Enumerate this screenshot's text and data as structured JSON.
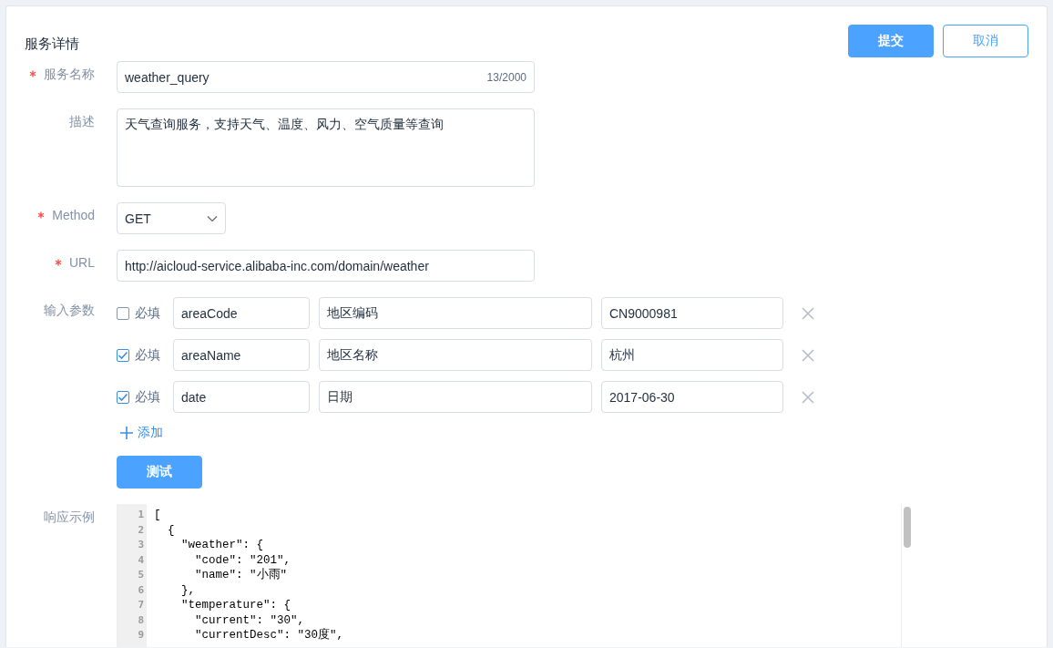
{
  "title": "服务详情",
  "actions": [
    {
      "label": "提交",
      "kind": "primary"
    },
    {
      "label": "取消",
      "kind": "secondary"
    }
  ],
  "fields": [
    {
      "label": "服务名称",
      "required": true,
      "kind": "text",
      "value": "weather_query",
      "counter": "13/2000"
    },
    {
      "label": "描述",
      "required": false,
      "kind": "textarea",
      "value": "天气查询服务，支持天气、温度、风力、空气质量等查询"
    },
    {
      "label": "Method",
      "required": true,
      "kind": "select",
      "value": "GET"
    },
    {
      "label": "URL",
      "required": true,
      "kind": "text",
      "value": "http://aicloud-service.alibaba-inc.com/domain/weather"
    }
  ],
  "params": {
    "label": "输入参数",
    "add_label": "添加",
    "test_label": "测试",
    "rows": [
      {
        "checked": false,
        "required_label": "必填",
        "name": "areaCode",
        "desc": "地区编码",
        "example": "CN9000981"
      },
      {
        "checked": true,
        "required_label": "必填",
        "name": "areaName",
        "desc": "地区名称",
        "example": "杭州"
      },
      {
        "checked": true,
        "required_label": "必填",
        "name": "date",
        "desc": "日期",
        "example": "2017-06-30"
      }
    ]
  },
  "response": {
    "label": "响应示例",
    "lines": [
      {
        "number": "1",
        "text": "["
      },
      {
        "number": "2",
        "text": "  {"
      },
      {
        "number": "3",
        "text": "    \"weather\": {"
      },
      {
        "number": "4",
        "text": "      \"code\": \"201\","
      },
      {
        "number": "5",
        "text": "      \"name\": \"小雨\""
      },
      {
        "number": "6",
        "text": "    },"
      },
      {
        "number": "7",
        "text": "    \"temperature\": {"
      },
      {
        "number": "8",
        "text": "      \"current\": \"30\","
      },
      {
        "number": "9",
        "text": "      \"currentDesc\": \"30度\","
      }
    ]
  }
}
